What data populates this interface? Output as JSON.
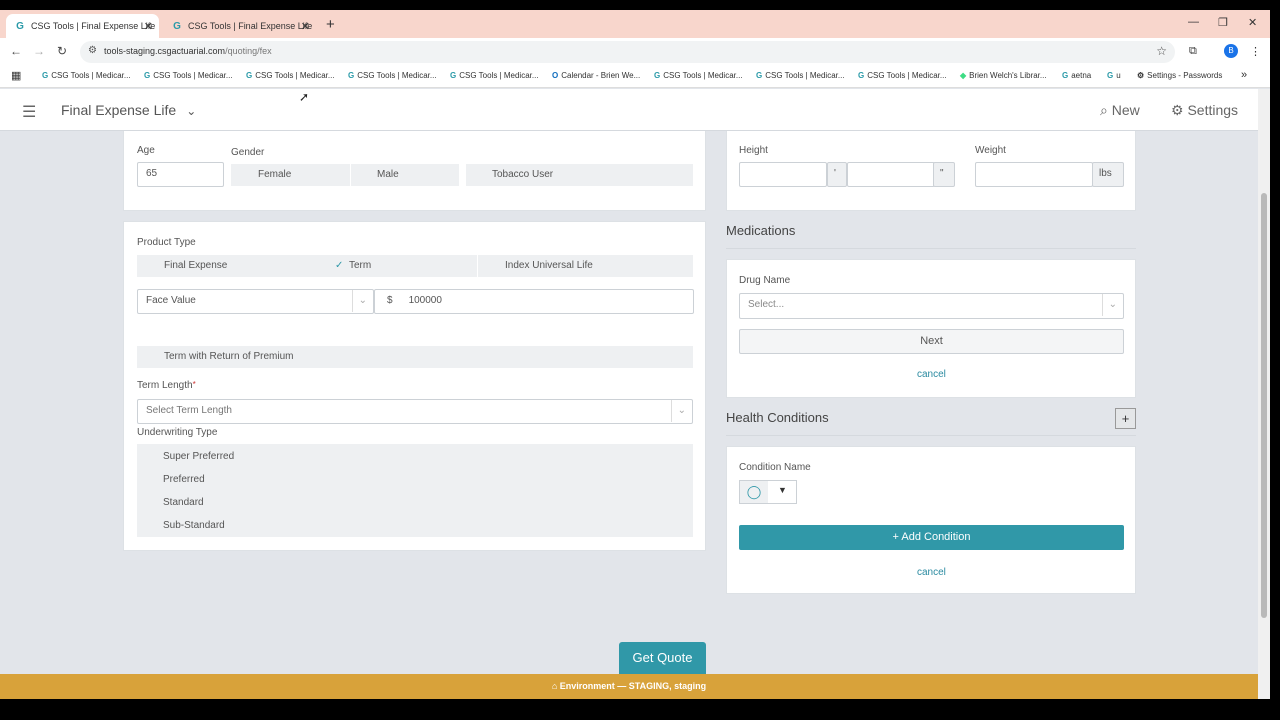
{
  "browser": {
    "tabs": [
      {
        "title": "CSG Tools | Final Expense Life"
      },
      {
        "title": "CSG Tools | Final Expense Life"
      }
    ],
    "url_host": "tools-staging.csgactuarial.com",
    "url_path": "/quoting/fex",
    "bookmarks": [
      "CSG Tools | Medicar...",
      "CSG Tools | Medicar...",
      "CSG Tools | Medicar...",
      "CSG Tools | Medicar...",
      "CSG Tools | Medicar...",
      "Calendar - Brien We...",
      "CSG Tools | Medicar...",
      "CSG Tools | Medicar...",
      "CSG Tools | Medicar...",
      "Brien Welch's Librar...",
      "aetna",
      "u",
      "Settings - Passwords"
    ],
    "profile_initial": "B"
  },
  "header": {
    "title": "Final Expense Life",
    "new_label": "New",
    "settings_label": "Settings"
  },
  "applicant": {
    "age_label": "Age",
    "age_value": "65",
    "gender_label": "Gender",
    "gender_female": "Female",
    "gender_male": "Male",
    "tobacco_label": "Tobacco User",
    "height_label": "Height",
    "height_ft_unit": "'",
    "height_in_unit": "\"",
    "weight_label": "Weight",
    "weight_unit": "lbs"
  },
  "product": {
    "type_label": "Product Type",
    "types": [
      "Final Expense",
      "Term",
      "Index Universal Life"
    ],
    "selected_type": "Term",
    "face_value_select": "Face Value",
    "currency": "$",
    "face_value": "100000",
    "rop_label": "Term with Return of Premium",
    "term_length_label": "Term Length",
    "required_mark": "*",
    "term_length_placeholder": "Select Term Length",
    "underwriting_label": "Underwriting Type",
    "underwriting_options": [
      "Super Preferred",
      "Preferred",
      "Standard",
      "Sub-Standard"
    ]
  },
  "medications": {
    "title": "Medications",
    "drug_label": "Drug Name",
    "drug_placeholder": "Select...",
    "next_label": "Next",
    "cancel_label": "cancel"
  },
  "health": {
    "title": "Health Conditions",
    "add_symbol": "+",
    "condition_label": "Condition Name",
    "add_condition_label": "+ Add Condition",
    "cancel_label": "cancel"
  },
  "footer": {
    "get_quote": "Get Quote",
    "environment": "Environment — STAGING, staging"
  },
  "colors": {
    "accent": "#3098a8",
    "env_bar": "#d8a23a",
    "tab_strip": "#f8d6cc"
  }
}
